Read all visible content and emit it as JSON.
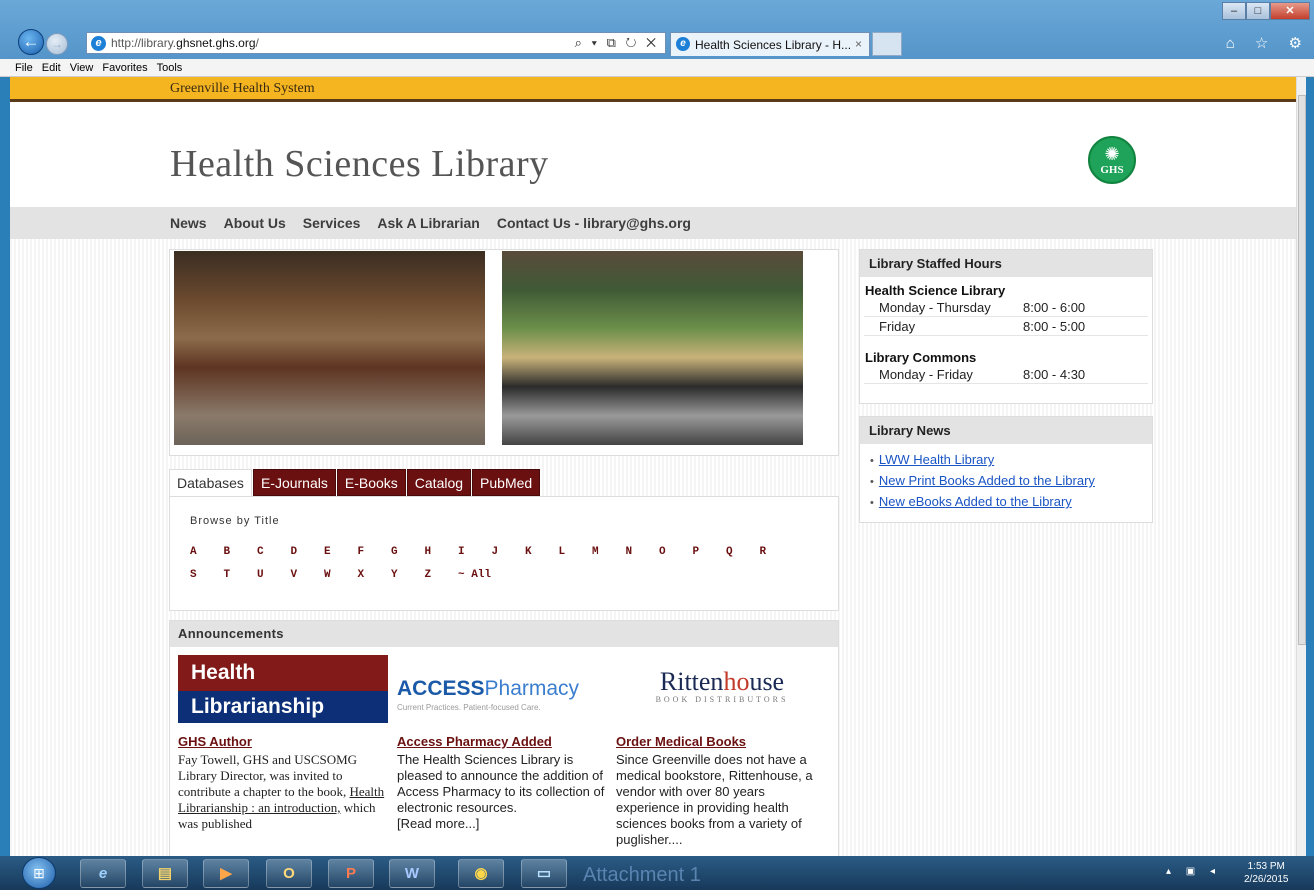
{
  "browser": {
    "url_prefix": "http://library.",
    "url_domain": "ghsnet.ghs.org",
    "url_suffix": "/",
    "addr_tools": "⌕ ▾ ⧉ ↻ ✕",
    "back_label": "←",
    "forward_label": "→",
    "tab_title": "Health Sciences Library - H...",
    "tab_close": "×",
    "window_buttons": {
      "minimize": "–",
      "maximize": "□",
      "close": "✕"
    },
    "toolbar_icons": "⌂ ☆ ⚙",
    "menu": [
      "File",
      "Edit",
      "View",
      "Favorites",
      "Tools"
    ]
  },
  "site": {
    "org_name": "Greenville Health System",
    "title": "Health Sciences Library",
    "logo": {
      "icon": "palm-icon",
      "text": "GHS",
      "color": "#1fa35a"
    },
    "nav": [
      "News",
      "About Us",
      "Services",
      "Ask A Librarian",
      "Contact Us - library@ghs.org"
    ]
  },
  "database_tabs": {
    "tabs": [
      "Databases",
      "E-Journals",
      "E-Books",
      "Catalog",
      "PubMed"
    ],
    "active": "Databases",
    "browse_label": "Browse by Title",
    "letters_row1": [
      "A",
      "B",
      "C",
      "D",
      "E",
      "F",
      "G",
      "H",
      "I",
      "J",
      "K",
      "L",
      "M",
      "N",
      "O",
      "P",
      "Q",
      "R"
    ],
    "letters_row2": [
      "S",
      "T",
      "U",
      "V",
      "W",
      "X",
      "Y",
      "Z"
    ],
    "all_label": "~ All"
  },
  "announcements": {
    "heading": "Announcements",
    "items": [
      {
        "image_line1": "Health",
        "image_line2": "Librarianship",
        "title": "GHS Author",
        "text_before": "Fay Towell, GHS and USCSOMG Library Director, was invited to contribute a chapter to the book, ",
        "link": "Health Librarianship : an introduction,",
        "text_after": " which was published"
      },
      {
        "logo_bold": "ACCESS",
        "logo_rest": "Pharmacy",
        "logo_sub": "Current Practices. Patient-focused Care.",
        "title": "Access Pharmacy Added",
        "text": "The Health Sciences Library is pleased to announce the addition of Access Pharmacy to its collection of electronic resources.",
        "more": "[Read more...]"
      },
      {
        "logo_a": "Ritten",
        "logo_b": "ho",
        "logo_c": "use",
        "logo_sub": "BOOK DISTRIBUTORS",
        "title": "Order Medical Books",
        "text": "Since Greenville does not have a medical bookstore, Rittenhouse, a vendor with over 80 years experience in providing health sciences books from a variety of puglisher...."
      }
    ]
  },
  "hours": {
    "heading": "Library Staffed Hours",
    "sections": [
      {
        "name": "Health Science Library",
        "rows": [
          {
            "days": "Monday - Thursday",
            "time": "8:00 - 6:00"
          },
          {
            "days": "Friday",
            "time": "8:00 - 5:00"
          }
        ]
      },
      {
        "name": "Library Commons",
        "rows": [
          {
            "days": "Monday - Friday",
            "time": "8:00 - 4:30"
          }
        ]
      }
    ]
  },
  "news": {
    "heading": "Library News",
    "items": [
      "LWW Health Library",
      "New Print Books Added to the Library",
      "New eBooks Added to the Library"
    ]
  },
  "taskbar": {
    "start_icon": "windows-start-icon",
    "label": "Attachment 1",
    "clock_time": "1:53 PM",
    "clock_date": "2/26/2015"
  }
}
